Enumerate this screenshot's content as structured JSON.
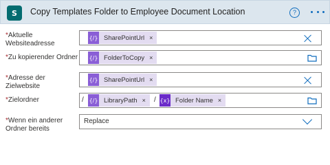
{
  "header": {
    "app_icon_letter": "S",
    "title": "Copy Templates Folder to Employee Document Location",
    "help_icon": "question-circle-icon",
    "more_icon": "ellipsis-icon"
  },
  "colors": {
    "header_bg": "#dce6ee",
    "accent": "#0f6cbd",
    "token_bg": "#e3dcf1",
    "token_chip": "#8a5ed6",
    "required": "#a4262c"
  },
  "fields": [
    {
      "label_line1": "Aktuelle",
      "label_line2": "Websiteadresse",
      "tokens": [
        {
          "chip": "{/}",
          "text": "SharePointUrl",
          "remove": "×"
        }
      ],
      "action_icon": "clear-icon"
    },
    {
      "label_line1": "Zu kopierender Ordner",
      "tokens": [
        {
          "chip": "{/}",
          "text": "FolderToCopy",
          "remove": "×"
        }
      ],
      "action_icon": "folder-icon"
    },
    {
      "label_line1": "Adresse der",
      "label_line2": "Zielwebsite",
      "tokens": [
        {
          "chip": "{/}",
          "text": "SharePointUrl",
          "remove": "×"
        }
      ],
      "action_icon": "clear-icon"
    },
    {
      "label_line1": "Zielordner",
      "separators": [
        "/",
        "/"
      ],
      "tokens": [
        {
          "chip": "{/}",
          "text": "LibraryPath",
          "remove": "×"
        },
        {
          "chip": "{x}",
          "text": "Folder Name",
          "remove": "×"
        }
      ],
      "action_icon": "folder-icon"
    },
    {
      "label_line1": "Wenn ein anderer",
      "label_line2": "Ordner bereits",
      "value": "Replace",
      "action_icon": "chevron-down-icon"
    }
  ],
  "required_marker": "*"
}
